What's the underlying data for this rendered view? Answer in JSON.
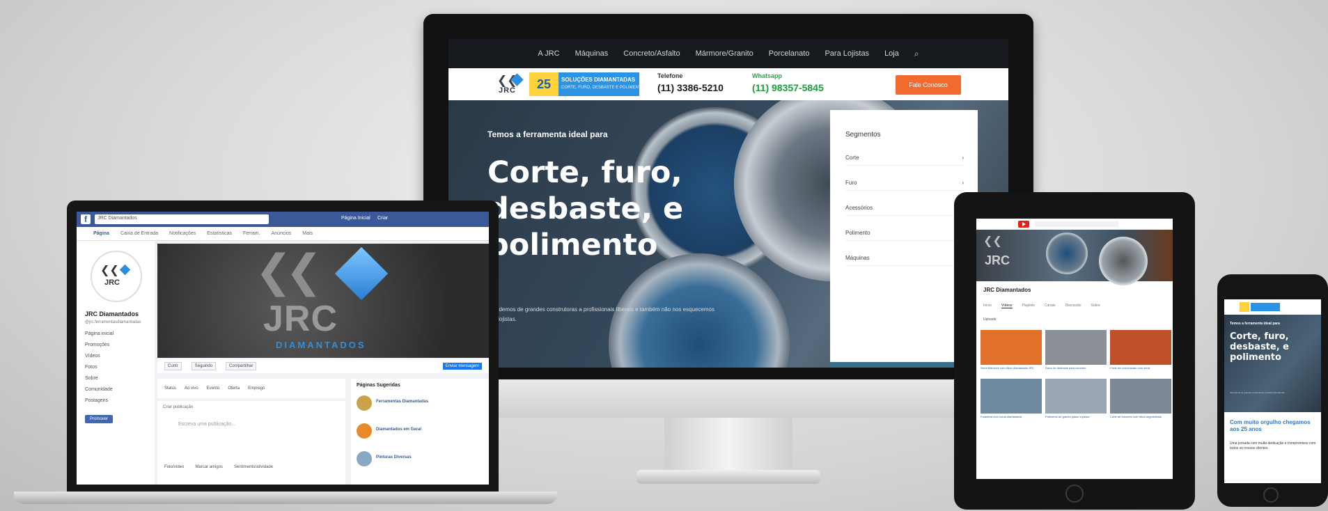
{
  "desktop": {
    "nav": [
      "A JRC",
      "Máquinas",
      "Concreto/Asfalto",
      "Mármore/Granito",
      "Porcelanato",
      "Para Lojistas",
      "Loja"
    ],
    "badge": {
      "title": "SOLUÇÕES DIAMANTADAS",
      "subtitle": "CORTE, FURO, DESBASTE E POLIMENTO"
    },
    "phone_label": "Telefone",
    "phone": "(11) 3386-5210",
    "whatsapp_label": "Whatsapp",
    "whatsapp": "(11) 98357-5845",
    "cta": "Fale Conosco",
    "hero": {
      "tagline": "Temos a ferramenta ideal para",
      "headline": "Corte, furo, desbaste, e polimento",
      "sub": "Atendemos de grandes construtoras a profissionais liberais e também não nos esquecemos dos lojistas."
    },
    "panel": {
      "heading": "Segmentos",
      "items": [
        "Corte",
        "Furo",
        "Acessórios",
        "Polimento",
        "Máquinas"
      ]
    }
  },
  "laptop": {
    "search": "JRC Diamantados",
    "top_right": [
      "Página Inicial",
      "Criar"
    ],
    "tabs": [
      "Página",
      "Caixa de Entrada",
      "Notificações",
      "Estatísticas",
      "Ferram.",
      "Anúncios",
      "Mais"
    ],
    "page_name": "JRC Diamantados",
    "handle": "@jrc.ferramentasdiamantadas",
    "side_items": [
      "Página inicial",
      "Promoções",
      "Vídeos",
      "Fotos",
      "Sobre",
      "Comunidade",
      "Postagens"
    ],
    "side_button": "Promover",
    "cover_text": "JRC",
    "cover_sub": "DIAMANTADOS",
    "actions": [
      "Curtir",
      "Seguindo",
      "Compartilhar",
      "Enviar mensagem"
    ],
    "post_tabs": [
      "Status",
      "Ao vivo",
      "Evento",
      "Oferta",
      "Emprego"
    ],
    "create_label": "Criar publicação",
    "create_placeholder": "Escreva uma publicação...",
    "create_row": [
      "Foto/vídeo",
      "Marcar amigos",
      "Sentimento/atividade"
    ],
    "suggest_heading": "Páginas Sugeridas",
    "suggestions": [
      "Ferramentas Diamantadas",
      "Diamantados em Geral",
      "Pinturas Diversas"
    ]
  },
  "tablet": {
    "channel": "JRC Diamantados",
    "tabs": [
      "Início",
      "Vídeos",
      "Playlists",
      "Canais",
      "Discussão",
      "Sobre"
    ],
    "sort": "Uploads",
    "videos": [
      {
        "title": "Serra Mármore com disco diamantado JRC",
        "color": "#e0702a"
      },
      {
        "title": "Disco de desbaste para concreto",
        "color": "#8a8f96"
      },
      {
        "title": "Corte em porcelanato com serra",
        "color": "#c0502a"
      },
      {
        "title": "Furadeira com coroa diamantada",
        "color": "#6f8aa0"
      },
      {
        "title": "Polimento de granito passo a passo",
        "color": "#9aa7b2"
      },
      {
        "title": "Corte de concreto com disco segmentado",
        "color": "#7d8a95"
      }
    ]
  },
  "phone": {
    "tagline": "Temos a ferramenta ideal para",
    "headline": "Corte, furo, desbaste, e polimento",
    "sub": "Atendemos de grandes construtoras a profissionais liberais.",
    "card_title": "Com muito orgulho chegamos aos 25 anos",
    "card_text": "Uma jornada com muita dedicação e compromisso com todos os nossos clientes."
  },
  "colors": {
    "accent": "#2a8fe0",
    "cta": "#f26a2e",
    "whatsapp": "#1e9d41",
    "facebook": "#3b5998"
  }
}
